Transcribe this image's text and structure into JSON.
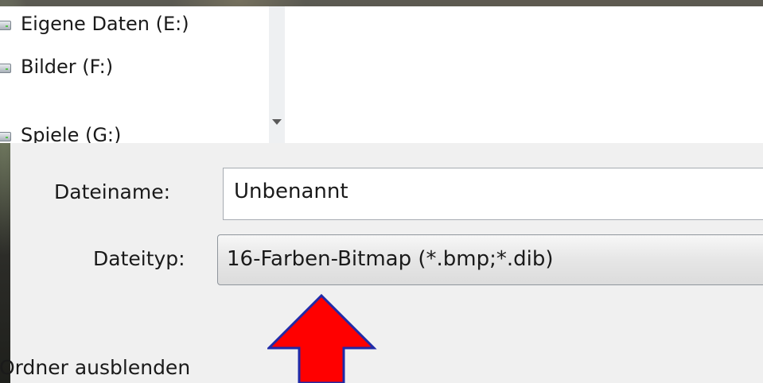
{
  "tree": {
    "items": [
      {
        "label": "Eigene Daten (E:)",
        "icon": "drive-icon"
      },
      {
        "label": "Bilder (F:)",
        "icon": "drive-icon"
      },
      {
        "label": "Spiele (G:)",
        "icon": "drive-icon"
      }
    ]
  },
  "form": {
    "filename_label": "Dateiname:",
    "filename_value": "Unbenannt",
    "filetype_label": "Dateityp:",
    "filetype_value": "16-Farben-Bitmap (*.bmp;*.dib)",
    "hide_folders_label": "Ordner ausblenden"
  },
  "annotation": {
    "arrow_color": "#ff0000",
    "arrow_outline": "#1f2aa8",
    "direction": "up"
  }
}
